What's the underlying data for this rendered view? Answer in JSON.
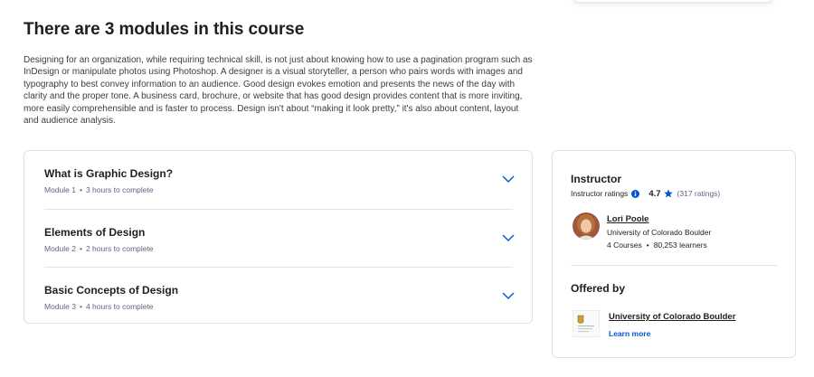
{
  "colors": {
    "accent": "#0056d2",
    "text": "#1f1f1f",
    "muted": "#5b6780",
    "border": "#e1e1e1"
  },
  "section": {
    "title": "There are 3 modules in this course",
    "description": "Designing for an organization, while requiring technical skill, is not just about knowing how to use a pagination program such as InDesign or manipulate photos using Photoshop. A designer is a visual storyteller, a person who pairs words with images and typography to best convey information to an audience. Good design evokes emotion and presents the news of the day with clarity and the proper tone. A business card, brochure, or website that has good design provides content that is more inviting, more easily comprehensible and is faster to process. Design isn't about “making it look pretty,” it's also about content, layout and audience analysis."
  },
  "modules": [
    {
      "title": "What is Graphic Design?",
      "module_label": "Module 1",
      "duration": "3 hours to complete",
      "icon": "chevron-down-icon"
    },
    {
      "title": "Elements of Design",
      "module_label": "Module 2",
      "duration": "2 hours to complete",
      "icon": "chevron-down-icon"
    },
    {
      "title": "Basic Concepts of Design",
      "module_label": "Module 3",
      "duration": "4 hours to complete",
      "icon": "chevron-down-icon"
    }
  ],
  "instructor": {
    "heading": "Instructor",
    "ratings_label": "Instructor ratings",
    "rating_value": "4.7",
    "rating_count": "(317 ratings)",
    "name": "Lori Poole",
    "organization": "University of Colorado Boulder",
    "courses": "4 Courses",
    "learners": "80,253 learners"
  },
  "offered_by": {
    "heading": "Offered by",
    "partner_name": "University of Colorado Boulder",
    "learn_more": "Learn more"
  }
}
